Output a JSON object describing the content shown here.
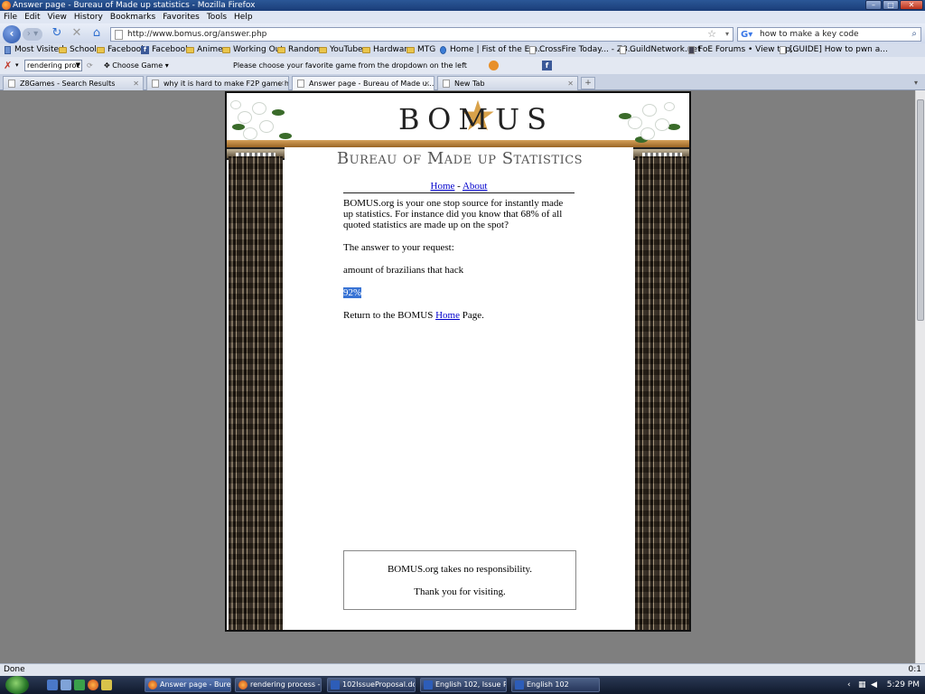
{
  "window": {
    "title": "Answer page - Bureau of Made up statistics - Mozilla Firefox"
  },
  "menu": [
    "File",
    "Edit",
    "View",
    "History",
    "Bookmarks",
    "Favorites",
    "Tools",
    "Help"
  ],
  "nav": {
    "url": "http://www.bomus.org/answer.php",
    "search_value": "how to make a key code"
  },
  "bookmarks": [
    {
      "label": "Most Visited",
      "icon": "folder"
    },
    {
      "label": "School",
      "icon": "folder"
    },
    {
      "label": "Facebook",
      "icon": "folder"
    },
    {
      "label": "Facebook",
      "icon": "facebook"
    },
    {
      "label": "Anime",
      "icon": "folder"
    },
    {
      "label": "Working Out",
      "icon": "folder"
    },
    {
      "label": "Random",
      "icon": "folder"
    },
    {
      "label": "YouTube",
      "icon": "folder"
    },
    {
      "label": "Hardware",
      "icon": "folder"
    },
    {
      "label": "MTG",
      "icon": "folder"
    },
    {
      "label": "Home | Fist of the Em...",
      "icon": "page"
    },
    {
      "label": "CrossFire Today... - Z8...",
      "icon": "page"
    },
    {
      "label": "GuildNetwork.net",
      "icon": "page"
    },
    {
      "label": "FoE Forums • View top...",
      "icon": "page"
    },
    {
      "label": "[GUIDE] How to pwn a...",
      "icon": "page"
    }
  ],
  "toolbar": {
    "select_value": "rendering proc",
    "choose_game": "Choose Game",
    "message": "Please choose your favorite game from the dropdown on the left"
  },
  "tabs": [
    {
      "label": "Z8Games - Search Results",
      "active": false
    },
    {
      "label": "why it is hard to make F2P game ha...",
      "active": false
    },
    {
      "label": "Answer page - Bureau of Made u...",
      "active": true
    },
    {
      "label": "New Tab",
      "active": false
    }
  ],
  "page": {
    "logo": "BOMUS",
    "subtitle": "Bureau of Made up Statistics",
    "nav_home": "Home",
    "nav_sep": "-",
    "nav_about": "About",
    "intro": "BOMUS.org is your one stop source for instantly made up statistics. For instance did you know that 68% of all quoted statistics are made up on the spot?",
    "request_label": "The answer to your request:",
    "query": "amount of brazilians that hack",
    "answer": "92%",
    "return_pre": "Return to the BOMUS ",
    "return_link": "Home",
    "return_post": " Page.",
    "footer_line1": "BOMUS.org takes no responsibility.",
    "footer_line2": "Thank you for visiting."
  },
  "status": {
    "text": "Done",
    "right": "0:1"
  },
  "taskbar": {
    "items": [
      {
        "label": "Answer page - Bure...",
        "active": true,
        "kind": "firefox"
      },
      {
        "label": "rendering process - ...",
        "active": false,
        "kind": "firefox"
      },
      {
        "label": "102IssueProposal.do...",
        "active": false,
        "kind": "doc"
      },
      {
        "label": "English 102, Issue Pr...",
        "active": false,
        "kind": "doc"
      },
      {
        "label": "English 102",
        "active": false,
        "kind": "doc"
      }
    ],
    "clock": "5:29 PM"
  }
}
